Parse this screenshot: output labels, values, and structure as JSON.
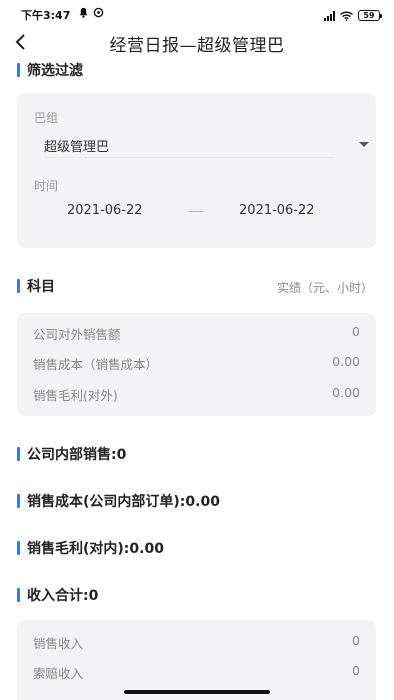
{
  "status_bar": {
    "time": "下午3:47",
    "battery": "59"
  },
  "nav": {
    "title": "经营日报—超级管理巴"
  },
  "filter": {
    "section_title": "筛选过滤",
    "group_label": "巴组",
    "group_value": "超级管理巴",
    "time_label": "时间",
    "start_date": "2021-06-22",
    "end_date": "2021-06-22"
  },
  "subjects": {
    "section_title": "科目",
    "unit_hint": "实绩（元、小时）",
    "rows": [
      {
        "label": "公司对外销售额",
        "value": "0"
      },
      {
        "label": "销售成本（销售成本）",
        "value": "0.00"
      },
      {
        "label": "销售毛利(对外)",
        "value": "0.00"
      }
    ]
  },
  "internal": {
    "internal_sales": "公司内部销售:0",
    "internal_cost": "销售成本(公司内部订单):0.00",
    "internal_profit": "销售毛利(对内):0.00",
    "income_total": "收入合计:0"
  },
  "income": {
    "rows": [
      {
        "label": "销售收入",
        "value": "0"
      },
      {
        "label": "索赔收入",
        "value": "0"
      }
    ]
  }
}
